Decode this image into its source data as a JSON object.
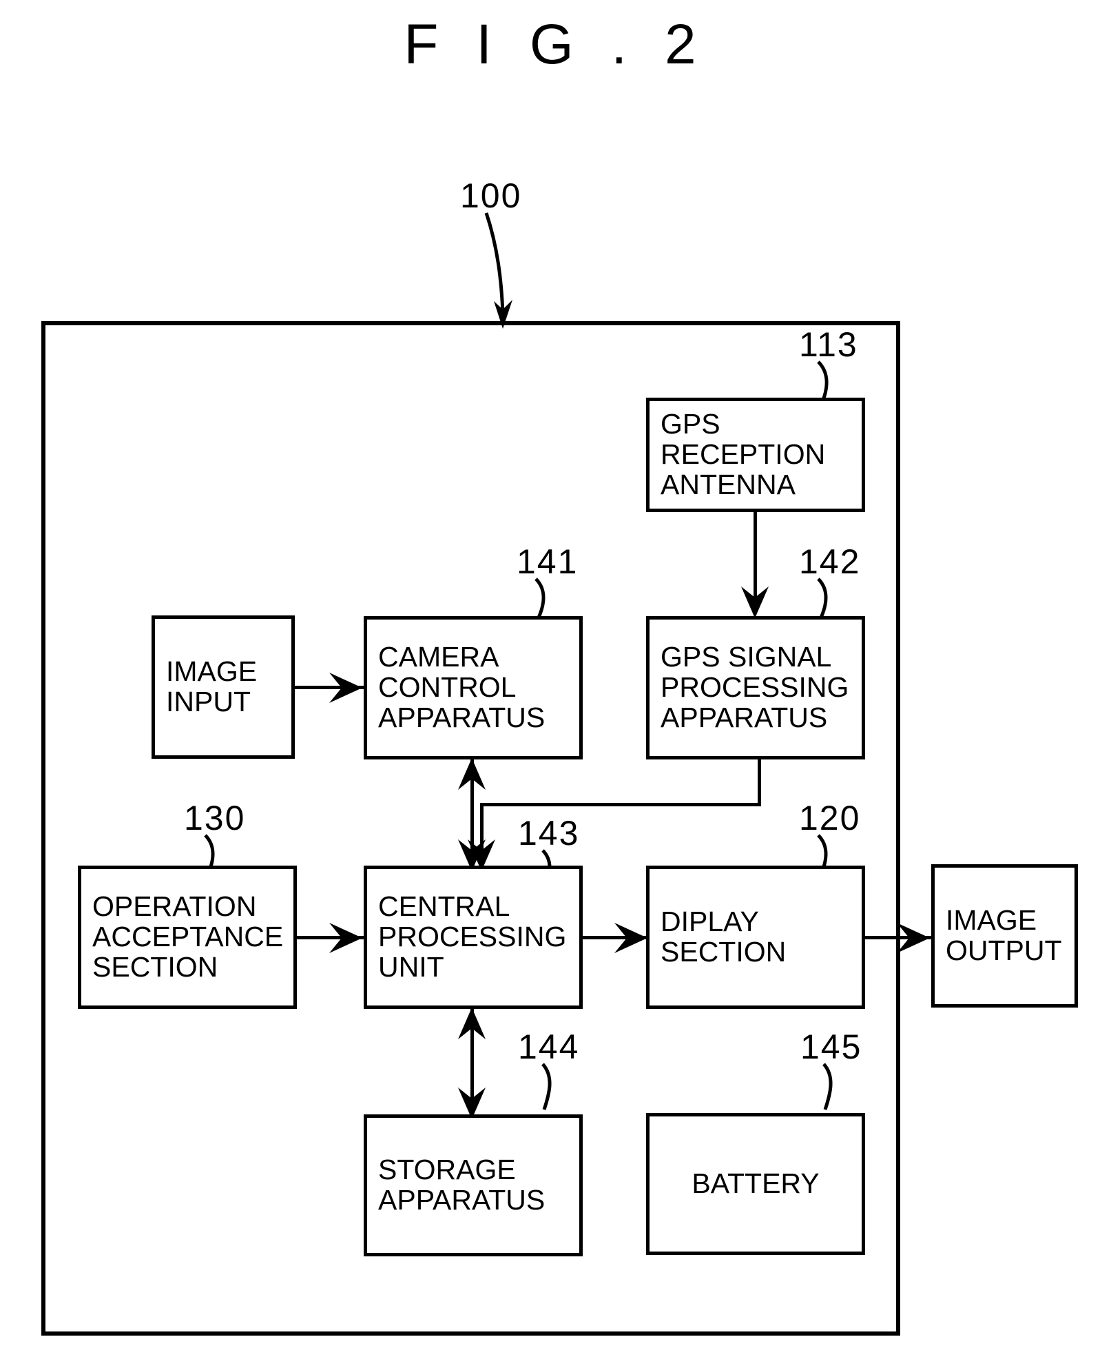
{
  "figure": {
    "title": "F I G . 2",
    "system_ref": "100"
  },
  "nodes": [
    {
      "id": "gps-reception-antenna",
      "label": "GPS\nRECEPTION\nANTENNA",
      "ref": "113"
    },
    {
      "id": "image-input",
      "label": "IMAGE\nINPUT",
      "ref": ""
    },
    {
      "id": "camera-control-apparatus",
      "label": "CAMERA\nCONTROL\nAPPARATUS",
      "ref": "141"
    },
    {
      "id": "gps-signal-processing-apparatus",
      "label": "GPS SIGNAL\nPROCESSING\nAPPARATUS",
      "ref": "142"
    },
    {
      "id": "operation-acceptance-section",
      "label": "OPERATION\nACCEPTANCE\nSECTION",
      "ref": "130"
    },
    {
      "id": "central-processing-unit",
      "label": "CENTRAL\nPROCESSING\nUNIT",
      "ref": "143"
    },
    {
      "id": "display-section",
      "label": "DIPLAY\nSECTION",
      "ref": "120"
    },
    {
      "id": "image-output",
      "label": "IMAGE\nOUTPUT",
      "ref": ""
    },
    {
      "id": "storage-apparatus",
      "label": "STORAGE\nAPPARATUS",
      "ref": "144"
    },
    {
      "id": "battery",
      "label": "BATTERY",
      "ref": "145"
    }
  ],
  "refs": {
    "system": "100",
    "gps_antenna": "113",
    "camera_control": "141",
    "gps_signal": "142",
    "cpu": "143",
    "operation": "130",
    "display": "120",
    "storage": "144",
    "battery": "145"
  },
  "labels": {
    "gps_reception_antenna_l1": "GPS",
    "gps_reception_antenna_l2": "RECEPTION",
    "gps_reception_antenna_l3": "ANTENNA",
    "image_input_l1": "IMAGE",
    "image_input_l2": "INPUT",
    "camera_control_l1": "CAMERA",
    "camera_control_l2": "CONTROL",
    "camera_control_l3": "APPARATUS",
    "gps_signal_l1": "GPS SIGNAL",
    "gps_signal_l2": "PROCESSING",
    "gps_signal_l3": "APPARATUS",
    "operation_l1": "OPERATION",
    "operation_l2": "ACCEPTANCE",
    "operation_l3": "SECTION",
    "cpu_l1": "CENTRAL",
    "cpu_l2": "PROCESSING",
    "cpu_l3": "UNIT",
    "display_l1": "DIPLAY",
    "display_l2": "SECTION",
    "image_output_l1": "IMAGE",
    "image_output_l2": "OUTPUT",
    "storage_l1": "STORAGE",
    "storage_l2": "APPARATUS",
    "battery_l1": "BATTERY"
  },
  "colors": {
    "ink": "#000000",
    "paper": "#ffffff"
  }
}
